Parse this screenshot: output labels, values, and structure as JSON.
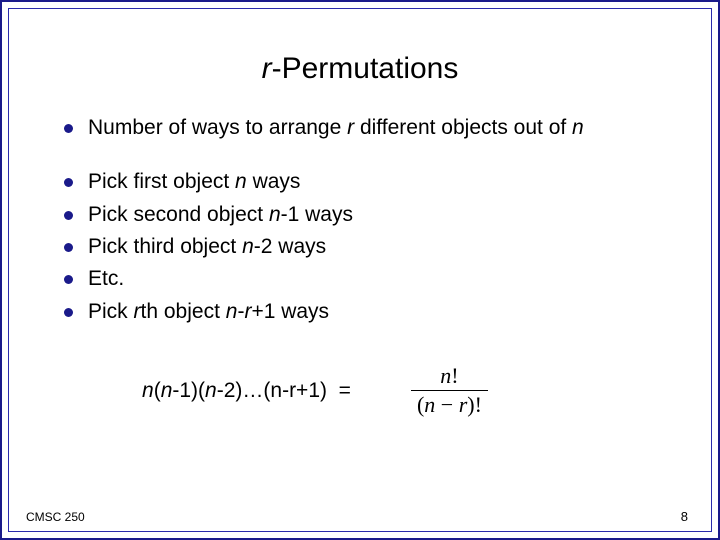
{
  "title": {
    "italic_part": "r",
    "rest": "-Permutations"
  },
  "bullets": {
    "b1": {
      "pre": "Number of ways to arrange ",
      "i1": "r",
      "mid": " different objects out of ",
      "i2": "n"
    },
    "b2": {
      "pre": "Pick first object ",
      "i1": "n",
      "post": " ways"
    },
    "b3": {
      "pre": "Pick second object ",
      "i1": "n",
      "post": "-1 ways"
    },
    "b4": {
      "pre": "Pick third object ",
      "i1": "n",
      "post": "-2 ways"
    },
    "b5": {
      "text": "Etc."
    },
    "b6": {
      "pre": "Pick ",
      "i1": "r",
      "mid": "th object  ",
      "i2": "n",
      "post1": "-",
      "i3": "r",
      "post2": "+1 ways"
    }
  },
  "formula": {
    "i1": "n",
    "p1": "(",
    "i2": "n",
    "p2": "-1)(",
    "i3": "n",
    "p3": "-2)…(n-r+1)  =",
    "frac_num_i": "n",
    "frac_num_rest": "!",
    "frac_den_p1": "(",
    "frac_den_i1": "n",
    "frac_den_mid": " − ",
    "frac_den_i2": "r",
    "frac_den_p2": ")!"
  },
  "footer": {
    "left": "CMSC 250",
    "right": "8"
  }
}
